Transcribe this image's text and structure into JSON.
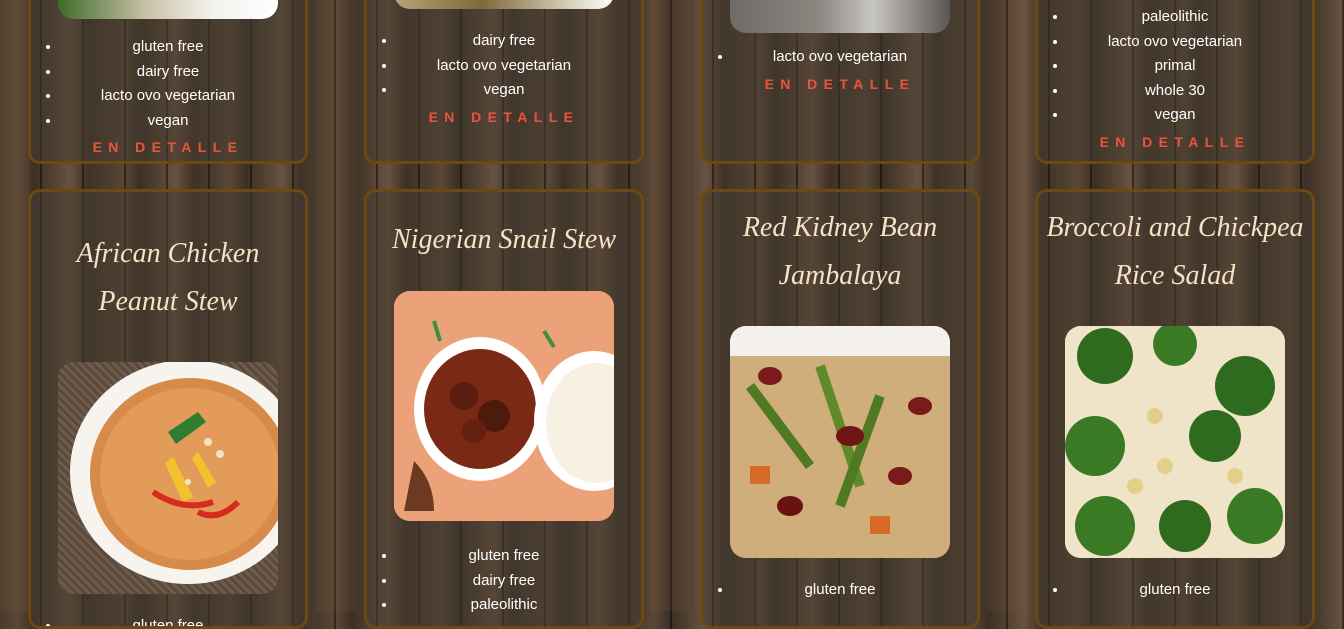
{
  "top_row": [
    {
      "diets": [
        "gluten free",
        "dairy free",
        "lacto ovo vegetarian",
        "vegan"
      ],
      "detail_label": "EN DETALLE"
    },
    {
      "diets": [
        "dairy free",
        "lacto ovo vegetarian",
        "vegan"
      ],
      "detail_label": "EN DETALLE"
    },
    {
      "diets": [
        "lacto ovo vegetarian"
      ],
      "detail_label": "EN DETALLE"
    },
    {
      "diets": [
        "paleolithic",
        "lacto ovo vegetarian",
        "primal",
        "whole 30",
        "vegan"
      ],
      "detail_label": "EN DETALLE"
    }
  ],
  "recipes": [
    {
      "title": "African Chicken Peanut Stew",
      "diets": [
        "gluten free"
      ]
    },
    {
      "title": "Nigerian Snail Stew",
      "diets": [
        "gluten free",
        "dairy free",
        "paleolithic"
      ]
    },
    {
      "title": "Red Kidney Bean Jambalaya",
      "diets": [
        "gluten free"
      ]
    },
    {
      "title": "Broccoli and Chickpea Rice Salad",
      "diets": [
        "gluten free"
      ]
    }
  ],
  "colors": {
    "card_border": "#6a4a12",
    "title_text": "#f6e2c4",
    "detail_link": "#e8543e"
  }
}
